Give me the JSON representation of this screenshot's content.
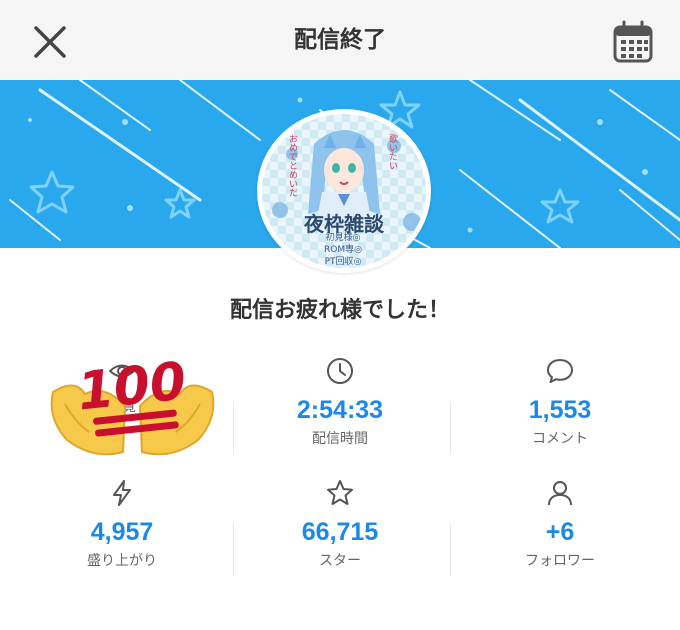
{
  "header": {
    "title": "配信終了",
    "close_icon": "close-icon",
    "calendar_icon": "calendar-icon"
  },
  "colors": {
    "accent": "#1e88e5",
    "banner": "#29a8ee",
    "header_bg": "#f5f5f5"
  },
  "avatar": {
    "title": "夜枠雑談",
    "lines": [
      "初見様◎",
      "ROM専◎",
      "PT回収◎"
    ],
    "side_texts": [
      "歌いたい",
      "おめでとめいだ"
    ]
  },
  "message": "配信お疲れ様でした！",
  "stats": [
    {
      "icon": "eye-icon",
      "value": "",
      "label": "閲覧"
    },
    {
      "icon": "clock-icon",
      "value": "2:54:33",
      "label": "配信時間"
    },
    {
      "icon": "comment-icon",
      "value": "1,553",
      "label": "コメント"
    },
    {
      "icon": "lightning-icon",
      "value": "4,957",
      "label": "盛り上がり"
    },
    {
      "icon": "star-icon",
      "value": "66,715",
      "label": "スター"
    },
    {
      "icon": "person-icon",
      "value": "+6",
      "label": "フォロワー"
    }
  ],
  "overlay": {
    "emoji_text": "100",
    "emoji_name": "hundred-points-emoji"
  }
}
